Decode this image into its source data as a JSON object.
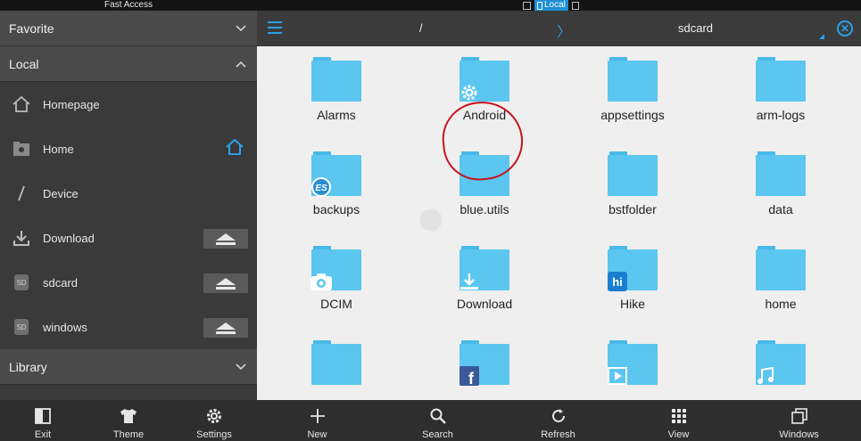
{
  "status_bar": {
    "title": "Fast Access",
    "local_label": "Local"
  },
  "sidebar": {
    "sections": {
      "favorite": "Favorite",
      "local": "Local",
      "library": "Library"
    },
    "items": [
      {
        "label": "Homepage",
        "icon": "house-outline-icon"
      },
      {
        "label": "Home",
        "icon": "home-folder-icon",
        "right_icon": "home-icon"
      },
      {
        "label": "Device",
        "icon": "slash-icon"
      },
      {
        "label": "Download",
        "icon": "download-icon",
        "eject": true
      },
      {
        "label": "sdcard",
        "icon": "sd-card-icon",
        "eject": true,
        "badge": "SD"
      },
      {
        "label": "windows",
        "icon": "sd-card-icon",
        "eject": true,
        "badge": "SD"
      }
    ]
  },
  "header": {
    "path_root": "/",
    "path_separator": "〉",
    "current_path": "sdcard",
    "accent": "#2aa0e8"
  },
  "files": [
    {
      "name": "Alarms",
      "badge": ""
    },
    {
      "name": "Android",
      "badge": "gear-icon"
    },
    {
      "name": "appsettings",
      "badge": ""
    },
    {
      "name": "arm-logs",
      "badge": ""
    },
    {
      "name": "backups",
      "badge": "es-logo-icon"
    },
    {
      "name": "blue.utils",
      "badge": ""
    },
    {
      "name": "bstfolder",
      "badge": ""
    },
    {
      "name": "data",
      "badge": ""
    },
    {
      "name": "DCIM",
      "badge": "camera-icon"
    },
    {
      "name": "Download",
      "badge": "download-icon"
    },
    {
      "name": "Hike",
      "badge": "hike-logo-icon"
    },
    {
      "name": "home",
      "badge": ""
    },
    {
      "name": "",
      "badge": ""
    },
    {
      "name": "",
      "badge": "facebook-icon"
    },
    {
      "name": "",
      "badge": "video-icon"
    },
    {
      "name": "",
      "badge": "music-note-icon"
    }
  ],
  "bottom_left": [
    {
      "label": "Exit",
      "icon": "exit-icon"
    },
    {
      "label": "Theme",
      "icon": "tshirt-icon"
    },
    {
      "label": "Settings",
      "icon": "gear-icon"
    }
  ],
  "bottom_main": [
    {
      "label": "New",
      "icon": "plus-icon"
    },
    {
      "label": "Search",
      "icon": "search-icon"
    },
    {
      "label": "Refresh",
      "icon": "refresh-icon"
    },
    {
      "label": "View",
      "icon": "grid-icon"
    },
    {
      "label": "Windows",
      "icon": "windows-icon"
    }
  ],
  "colors": {
    "folder": "#5bc6ef",
    "highlight_circle": "#c8141e",
    "sidebar_bg": "#3a3a3a"
  }
}
